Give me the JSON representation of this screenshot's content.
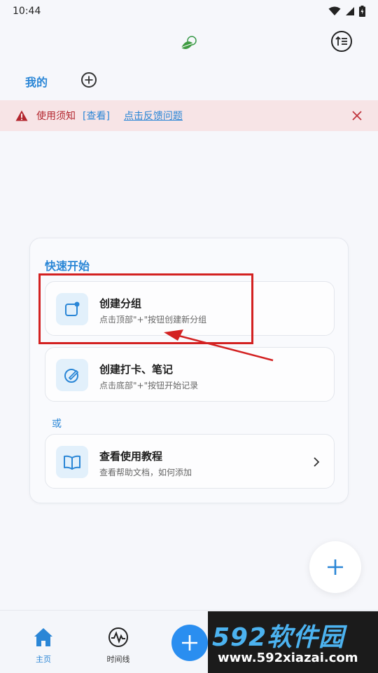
{
  "status_bar": {
    "time": "10:44",
    "icons": [
      "wifi-icon",
      "signal-icon",
      "battery-charging-icon"
    ]
  },
  "header": {
    "logo_icon": "sprout-logo",
    "sort_icon": "sort-up-icon"
  },
  "tabs": {
    "active": "我的",
    "add_icon": "plus-circle-icon"
  },
  "notice": {
    "title": "使用须知",
    "view_link": "[查看]",
    "feedback_link": "点击反馈问题",
    "close_icon": "close-icon"
  },
  "quick_start": {
    "title": "快速开始",
    "options": [
      {
        "title": "创建分组",
        "subtitle": "点击顶部\"+\"按钮创建新分组",
        "icon": "square-dot-icon"
      },
      {
        "title": "创建打卡、笔记",
        "subtitle": "点击底部\"+\"按钮开始记录",
        "icon": "pen-circle-icon"
      }
    ],
    "or_label": "或",
    "tutorial": {
      "title": "查看使用教程",
      "subtitle": "查看帮助文档，如何添加",
      "icon": "book-icon"
    }
  },
  "bottom_nav": {
    "home_label": "主页",
    "timeline_label": "时间线",
    "add_icon": "plus-icon"
  },
  "watermark": {
    "brand": "592软件园",
    "url": "www.592xiazai.com"
  },
  "colors": {
    "accent": "#2a86d6",
    "notice_bg": "#f7e4e6",
    "notice_text": "#b3262e",
    "annotation": "#d32121",
    "fab_blue": "#2a8ef0"
  }
}
